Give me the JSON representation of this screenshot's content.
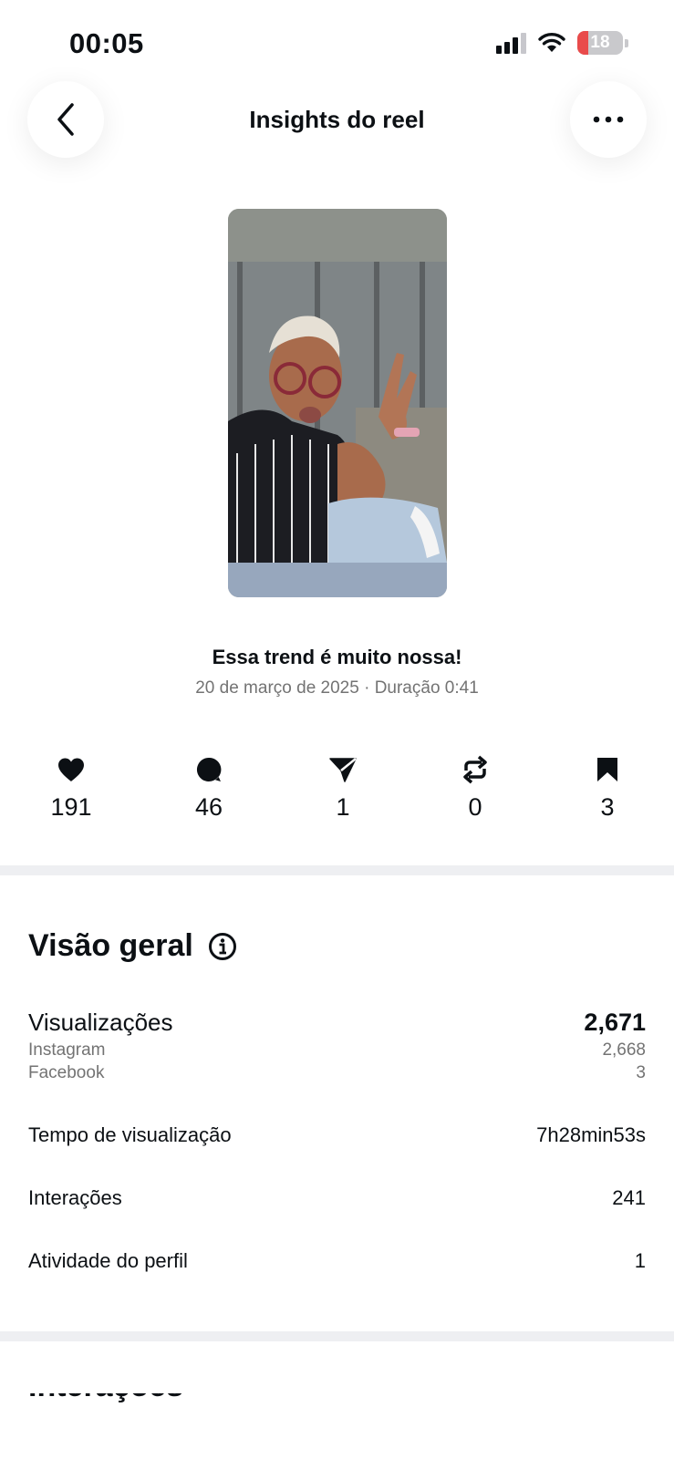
{
  "status_bar": {
    "time": "00:05",
    "battery": "18"
  },
  "header": {
    "title": "Insights do reel"
  },
  "reel": {
    "caption": "Essa trend é muito nossa!",
    "meta": "20 de março de 2025 · Duração 0:41"
  },
  "metrics": [
    {
      "icon": "heart-icon",
      "value": "191"
    },
    {
      "icon": "comment-icon",
      "value": "46"
    },
    {
      "icon": "share-icon",
      "value": "1"
    },
    {
      "icon": "repost-icon",
      "value": "0"
    },
    {
      "icon": "bookmark-icon",
      "value": "3"
    }
  ],
  "overview": {
    "title": "Visão geral",
    "views": {
      "label": "Visualizações",
      "value": "2,671",
      "instagram_label": "Instagram",
      "instagram_value": "2,668",
      "facebook_label": "Facebook",
      "facebook_value": "3"
    },
    "watch_time": {
      "label": "Tempo de visualização",
      "value": "7h28min53s"
    },
    "interactions": {
      "label": "Interações",
      "value": "241"
    },
    "profile_activity": {
      "label": "Atividade do perfil",
      "value": "1"
    }
  },
  "next_section": {
    "title": "Interações"
  }
}
